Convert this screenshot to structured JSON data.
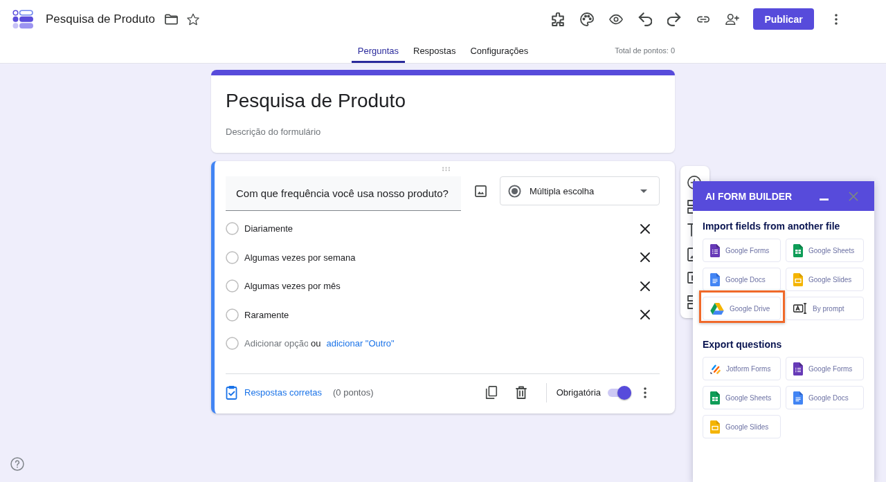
{
  "app_bar": {
    "title": "Pesquisa de Produto",
    "publish_button": "Publicar"
  },
  "tabs": [
    {
      "label": "Perguntas",
      "selected": true
    },
    {
      "label": "Respostas",
      "selected": false
    },
    {
      "label": "Configurações",
      "selected": false
    }
  ],
  "total_points": "Total de pontos: 0",
  "form_header": {
    "title": "Pesquisa de Produto",
    "description": {
      "placeholder": "Descrição do formulário"
    }
  },
  "question": {
    "title": {
      "value": "Com que frequência você usa nosso produto?"
    },
    "type_dropdown": "Múltipla escolha",
    "options": [
      "Diariamente",
      "Algumas vezes por semana",
      "Algumas vezes por mês",
      "Raramente"
    ],
    "add_option": {
      "placeholder": "Adicionar opção"
    },
    "or_text": "ou",
    "add_other_link": "adicionar \"Outro\"",
    "answer_key_link": "Respostas corretas",
    "points": "(0 pontos)",
    "required": {
      "label": "Obrigatória",
      "on": true
    }
  },
  "ai_form_builder": {
    "title": "AI FORM BUILDER",
    "sections": [
      {
        "heading": "Import fields from another file",
        "items": [
          {
            "label": "Google Forms",
            "kind": "forms",
            "highlighted": false
          },
          {
            "label": "Google Sheets",
            "kind": "sheets",
            "highlighted": false
          },
          {
            "label": "Google Docs",
            "kind": "docs",
            "highlighted": false
          },
          {
            "label": "Google Slides",
            "kind": "slides",
            "highlighted": false
          },
          {
            "label": "Google Drive",
            "kind": "drive",
            "highlighted": true
          },
          {
            "label": "By prompt",
            "kind": "prompt",
            "highlighted": false
          }
        ]
      },
      {
        "heading": "Export questions",
        "items": [
          {
            "label": "Jotform Forms",
            "kind": "jotform",
            "highlighted": false
          },
          {
            "label": "Google Forms",
            "kind": "forms",
            "highlighted": false
          },
          {
            "label": "Google Sheets",
            "kind": "sheets",
            "highlighted": false
          },
          {
            "label": "Google Docs",
            "kind": "docs",
            "highlighted": false
          },
          {
            "label": "Google Slides",
            "kind": "slides",
            "highlighted": false
          }
        ]
      }
    ]
  }
}
